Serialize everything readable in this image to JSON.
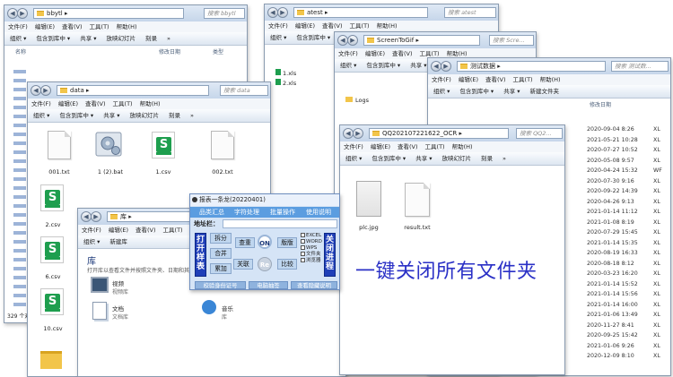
{
  "common": {
    "menu": [
      "文件(F)",
      "编辑(E)",
      "查看(V)",
      "工具(T)",
      "帮助(H)"
    ],
    "toolbar": [
      "组织 ▾",
      "包含到库中 ▾",
      "共享 ▾",
      "放映幻灯片",
      "刻录",
      "»"
    ]
  },
  "win_bbytl": {
    "path": "bbytl ▸",
    "search": "搜索 bbytl",
    "col_name": "名称",
    "col_date": "修改日期",
    "col_type": "类型",
    "status": "329 个对"
  },
  "win_data": {
    "path": "data ▸",
    "search": "搜索 data",
    "files": [
      "001.txt",
      "1 (2).bat",
      "1.csv",
      "002.txt",
      "2.csv",
      "6.csv",
      "10.csv"
    ]
  },
  "win_lib": {
    "path": "库 ▸",
    "toolbar_new": "新建库",
    "title": "库",
    "desc": "打开库以查看文件并按照文件夹、日期和其他属",
    "items": [
      "视频",
      "视频库",
      "文档",
      "文档库",
      "音乐",
      "库"
    ],
    "count": "141"
  },
  "win_atest": {
    "path": "atest ▸",
    "search": "搜索 atest",
    "files": [
      "1.xls",
      "2.xls"
    ]
  },
  "win_screentogif": {
    "path": "ScreenToGif ▸",
    "search": "搜索 Scre...",
    "folder": "Logs"
  },
  "win_testdata": {
    "path": "测试数据 ▸",
    "search": "搜索 测试数...",
    "new_folder": "新建文件夹",
    "col_date": "修改日期",
    "dates": [
      "2020-09-04 8:26",
      "2021-05-21 10:28",
      "2020-07-27 10:52",
      "2020-05-08 9:57",
      "2020-04-24 15:32",
      "2020-07-30 9:16",
      "2020-09-22 14:39",
      "2020-04-26 9:13",
      "2021-01-14 11:12",
      "2021-01-08 8:19",
      "2020-07-29 15:45",
      "2021-01-14 15:35",
      "2020-08-19 16:33",
      "2020-08-18 8:12",
      "2020-03-23 16:20",
      "2021-01-14 15:52",
      "2021-01-14 15:56",
      "2021-01-14 16:00",
      "2021-01-06 13:49",
      "2020-11-27 8:41",
      "2020-09-25 15:42",
      "2021-01-06 9:26",
      "2020-12-09 8:10"
    ],
    "types": [
      "XL",
      "XL",
      "XL",
      "XL",
      "WF",
      "XL",
      "XL",
      "XL",
      "XL",
      "XL",
      "XL",
      "XL",
      "XL",
      "XL",
      "XL",
      "XL",
      "XL",
      "XL",
      "XL",
      "XL",
      "XL",
      "XL",
      "XL"
    ]
  },
  "win_ocr": {
    "path": "QQ20210722162​2_OCR ▸",
    "search": "搜索 QQ2...",
    "files": [
      "plc.jpg",
      "result.txt"
    ]
  },
  "tool": {
    "title": "报表一条龙(20220401)",
    "tabs": [
      "品类汇总",
      "字符处理",
      "批量操作",
      "使用说明"
    ],
    "addr_label": "地址栏：",
    "open_btn": "打开样表",
    "close_btn": "关闭进程",
    "buttons": [
      "拆分",
      "查重",
      "合并",
      "关联",
      "累加",
      "比较",
      "版版"
    ],
    "on_label": "ON",
    "re_label": "Re",
    "checks": [
      "EXCEL",
      "WORD",
      "WPS",
      "文件夹",
      "浏览器"
    ],
    "bottom": [
      "校验身份证号",
      "电脑抽签",
      "查看隐藏说明"
    ]
  },
  "banner": "一键关闭所有文件夹"
}
